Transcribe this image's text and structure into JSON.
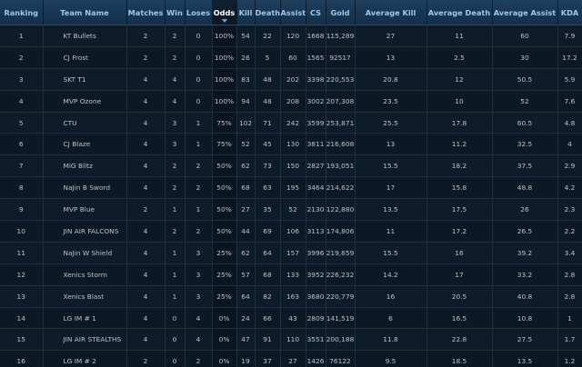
{
  "headers": [
    "Ranking",
    "Team Name",
    "Matches",
    "Win",
    "Loses",
    "Odds",
    "Kill",
    "Death",
    "Assist",
    "CS",
    "Gold",
    "Average Kill",
    "Average Death",
    "Average Assist",
    "KDA"
  ],
  "sorted_column": "Odds",
  "rows": [
    [
      "1",
      "KT Bullets",
      "2",
      "2",
      "0",
      "100%",
      "54",
      "22",
      "120",
      "1668",
      "115,289",
      "27",
      "11",
      "60",
      "7.9"
    ],
    [
      "2",
      "CJ Frost",
      "2",
      "2",
      "0",
      "100%",
      "26",
      "5",
      "60",
      "1565",
      "92517",
      "13",
      "2.5",
      "30",
      "17.2"
    ],
    [
      "3",
      "SKT T1",
      "4",
      "4",
      "0",
      "100%",
      "83",
      "48",
      "202",
      "3398",
      "220,553",
      "20.8",
      "12",
      "50.5",
      "5.9"
    ],
    [
      "4",
      "MVP Ozone",
      "4",
      "4",
      "0",
      "100%",
      "94",
      "48",
      "208",
      "3002",
      "207,308",
      "23.5",
      "10",
      "52",
      "7.6"
    ],
    [
      "5",
      "CTU",
      "4",
      "3",
      "1",
      "75%",
      "102",
      "71",
      "242",
      "3599",
      "253,871",
      "25.5",
      "17.8",
      "60.5",
      "4.8"
    ],
    [
      "6",
      "CJ Blaze",
      "4",
      "3",
      "1",
      "75%",
      "52",
      "45",
      "130",
      "3811",
      "216,608",
      "13",
      "11.2",
      "32.5",
      "4"
    ],
    [
      "7",
      "MiG Blitz",
      "4",
      "2",
      "2",
      "50%",
      "62",
      "73",
      "150",
      "2827",
      "193,051",
      "15.5",
      "18.2",
      "37.5",
      "2.9"
    ],
    [
      "8",
      "NaJin B Sword",
      "4",
      "2",
      "2",
      "50%",
      "68",
      "63",
      "195",
      "3464",
      "214,622",
      "17",
      "15.8",
      "48.8",
      "4.2"
    ],
    [
      "9",
      "MVP Blue",
      "2",
      "1",
      "1",
      "50%",
      "27",
      "35",
      "52",
      "2130",
      "122,880",
      "13.5",
      "17.5",
      "26",
      "2.3"
    ],
    [
      "10",
      "JIN AIR FALCONS",
      "4",
      "2",
      "2",
      "50%",
      "44",
      "69",
      "106",
      "3113",
      "174,806",
      "11",
      "17.2",
      "26.5",
      "2.2"
    ],
    [
      "11",
      "NaJin W Shield",
      "4",
      "1",
      "3",
      "25%",
      "62",
      "64",
      "157",
      "3996",
      "219,659",
      "15.5",
      "16",
      "39.2",
      "3.4"
    ],
    [
      "12",
      "Xenics Storm",
      "4",
      "1",
      "3",
      "25%",
      "57",
      "68",
      "133",
      "3952",
      "226,232",
      "14.2",
      "17",
      "33.2",
      "2.8"
    ],
    [
      "13",
      "Xenics Blast",
      "4",
      "1",
      "3",
      "25%",
      "64",
      "82",
      "163",
      "3680",
      "220,779",
      "16",
      "20.5",
      "40.8",
      "2.8"
    ],
    [
      "14",
      "LG IM # 1",
      "4",
      "0",
      "4",
      "0%",
      "24",
      "66",
      "43",
      "2809",
      "141,519",
      "6",
      "16.5",
      "10.8",
      "1"
    ],
    [
      "15",
      "JIN AIR STEALTHS",
      "4",
      "0",
      "4",
      "0%",
      "47",
      "91",
      "110",
      "3551",
      "200,188",
      "11.8",
      "22.8",
      "27.5",
      "1.7"
    ],
    [
      "16",
      "LG IM # 2",
      "2",
      "0",
      "2",
      "0%",
      "19",
      "37",
      "27",
      "1426",
      "76122",
      "9.5",
      "18.5",
      "13.5",
      "1.2"
    ]
  ]
}
